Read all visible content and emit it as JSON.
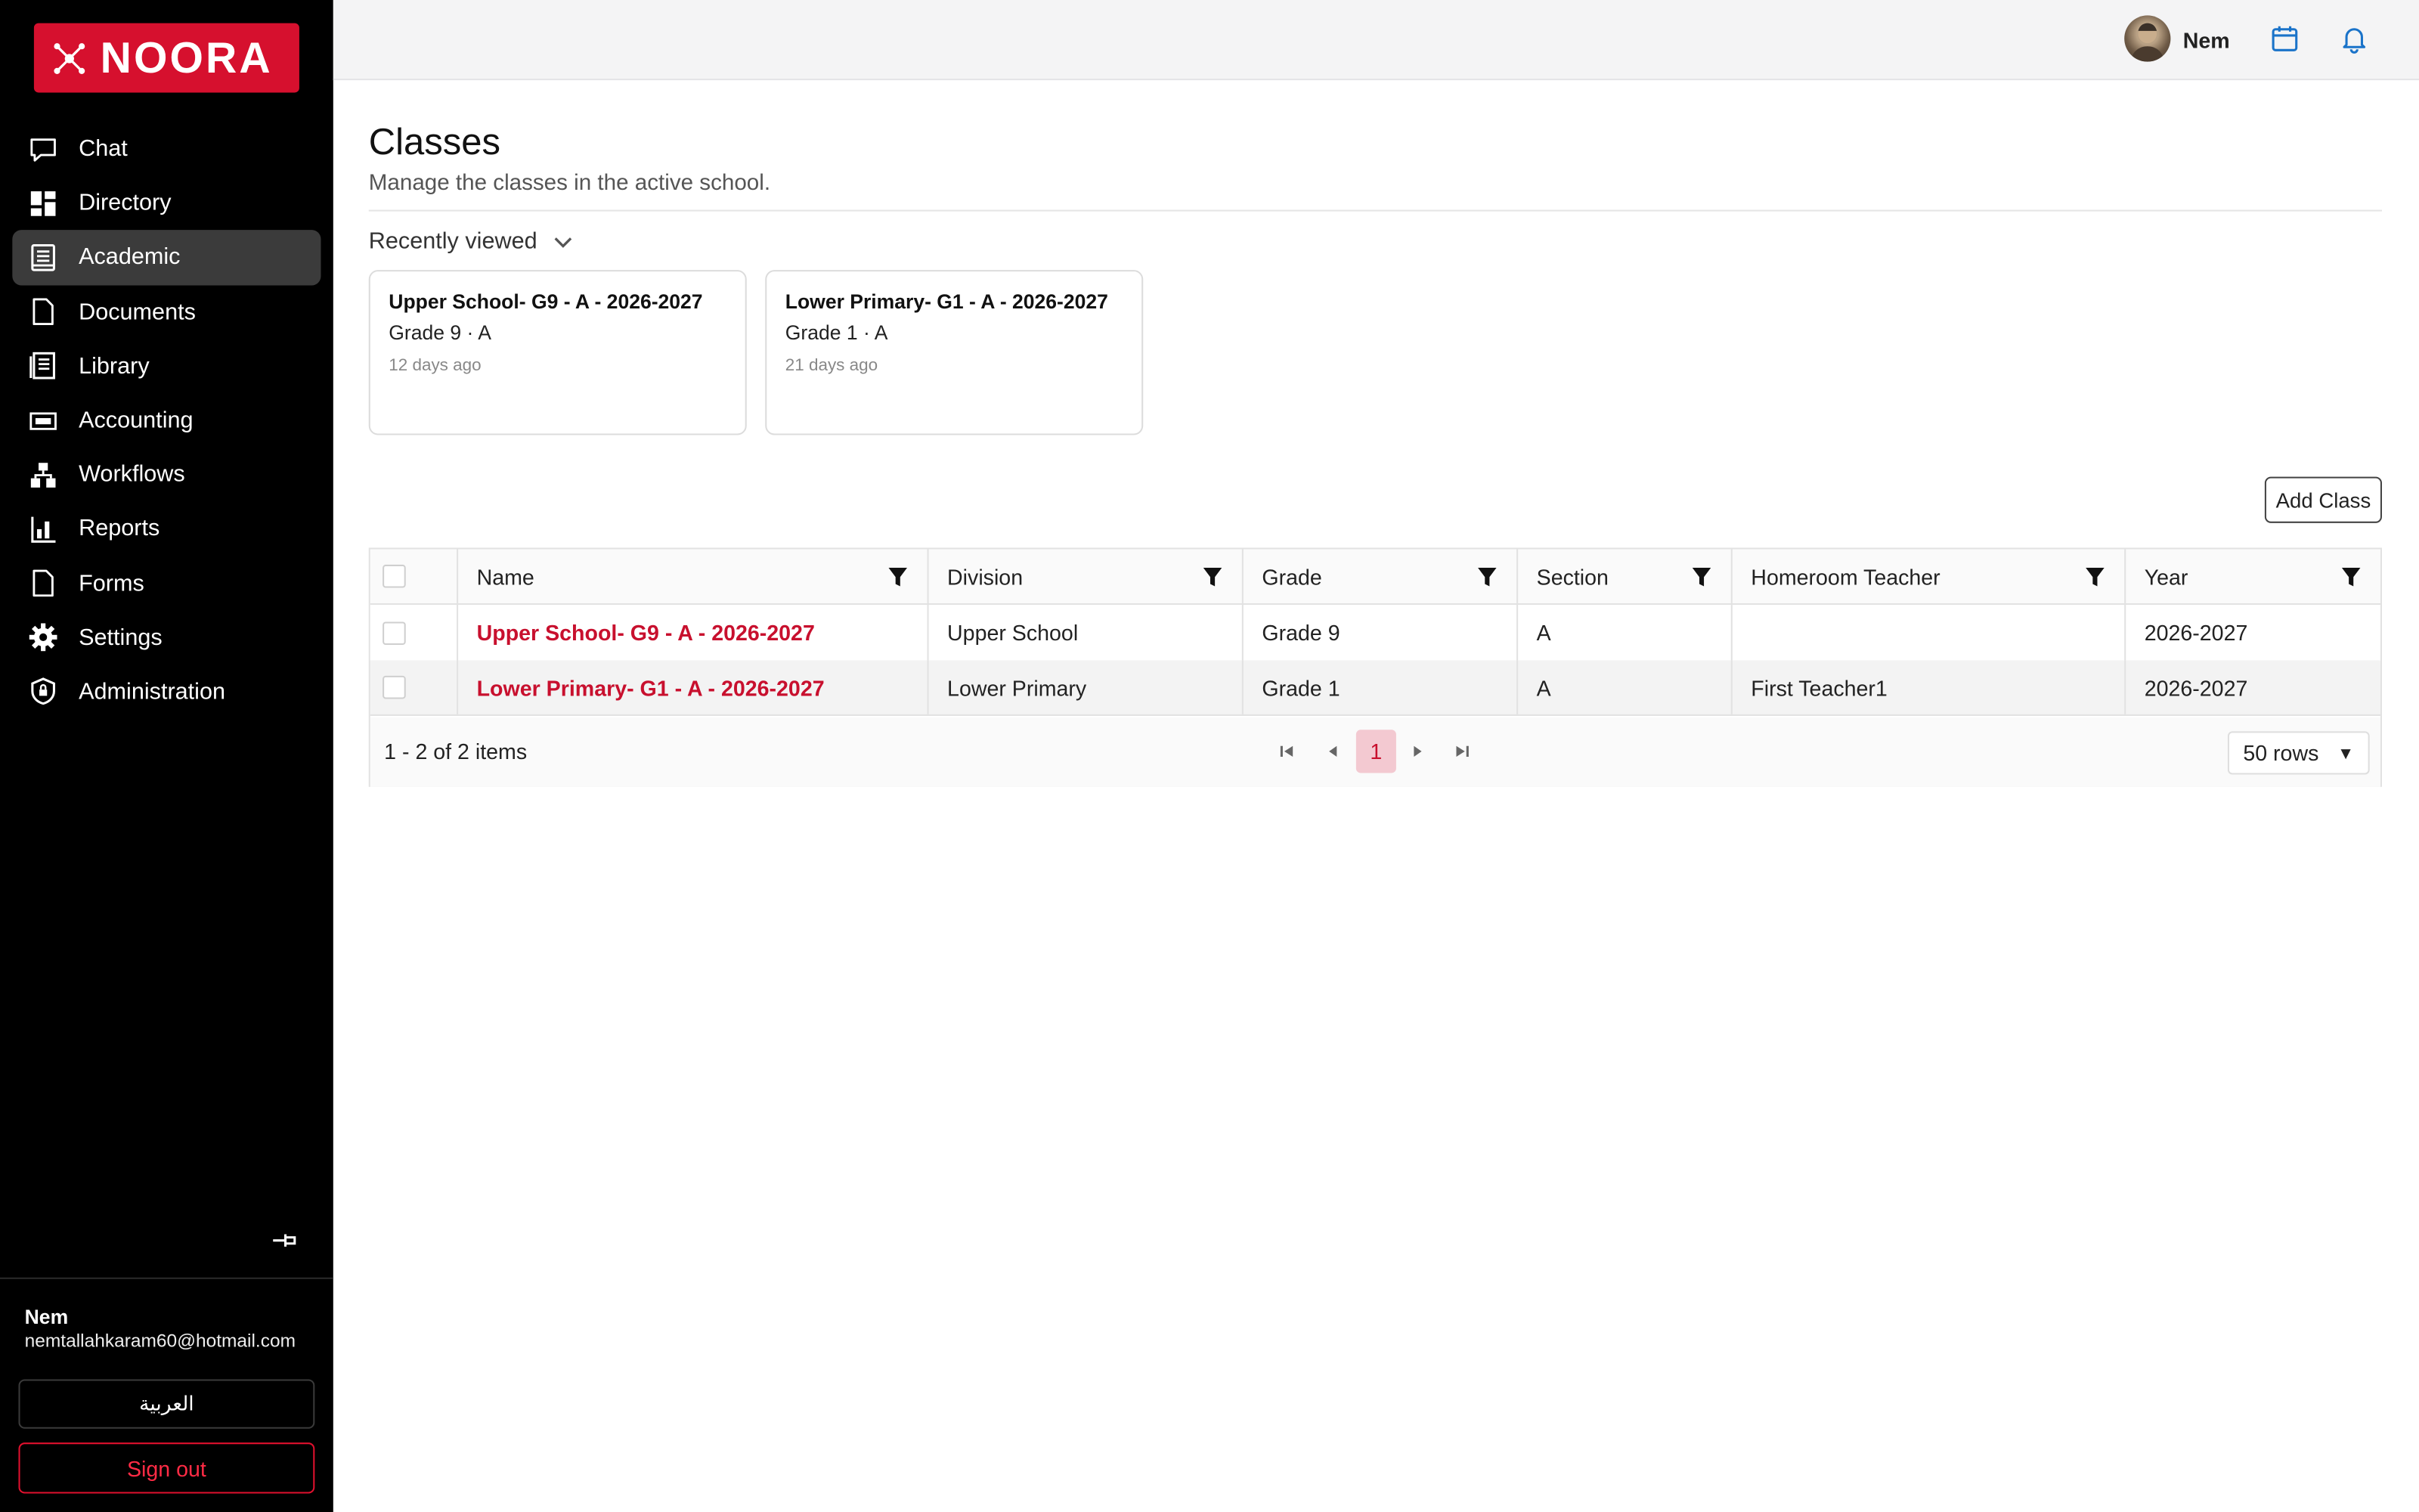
{
  "app": {
    "logo_text": "NOORA"
  },
  "sidebar": {
    "items": [
      {
        "label": "Chat",
        "icon": "chat-icon"
      },
      {
        "label": "Directory",
        "icon": "grid-icon"
      },
      {
        "label": "Academic",
        "icon": "book-icon",
        "active": true
      },
      {
        "label": "Documents",
        "icon": "document-icon"
      },
      {
        "label": "Library",
        "icon": "library-icon"
      },
      {
        "label": "Accounting",
        "icon": "money-icon"
      },
      {
        "label": "Workflows",
        "icon": "workflow-icon"
      },
      {
        "label": "Reports",
        "icon": "reports-icon"
      },
      {
        "label": "Forms",
        "icon": "form-icon"
      },
      {
        "label": "Settings",
        "icon": "gear-icon"
      },
      {
        "label": "Administration",
        "icon": "shield-icon"
      }
    ],
    "user_name": "Nem",
    "user_email": "nemtallahkaram60@hotmail.com",
    "language_button": "العربية",
    "signout_button": "Sign out"
  },
  "topbar": {
    "user_name": "Nem"
  },
  "page": {
    "title": "Classes",
    "subtitle": "Manage the classes in the active school.",
    "recent_label": "Recently viewed",
    "recent": [
      {
        "title": "Upper School- G9 - A - 2026-2027",
        "subtitle": "Grade 9 · A",
        "time": "12 days ago"
      },
      {
        "title": "Lower Primary- G1 - A - 2026-2027",
        "subtitle": "Grade 1 · A",
        "time": "21 days ago"
      }
    ],
    "add_button": "Add Class"
  },
  "table": {
    "columns": [
      "Name",
      "Division",
      "Grade",
      "Section",
      "Homeroom Teacher",
      "Year"
    ],
    "rows": [
      {
        "name": "Upper School- G9 - A - 2026-2027",
        "division": "Upper School",
        "grade": "Grade 9",
        "section": "A",
        "teacher": "",
        "year": "2026-2027"
      },
      {
        "name": "Lower Primary- G1 - A - 2026-2027",
        "division": "Lower Primary",
        "grade": "Grade 1",
        "section": "A",
        "teacher": "First Teacher1",
        "year": "2026-2027"
      }
    ],
    "pager_info": "1 - 2 of 2 items",
    "current_page": "1",
    "rows_per_page": "50 rows"
  },
  "colors": {
    "brand": "#d6102e",
    "link": "#c8102e",
    "sidebar_bg": "#000000"
  }
}
